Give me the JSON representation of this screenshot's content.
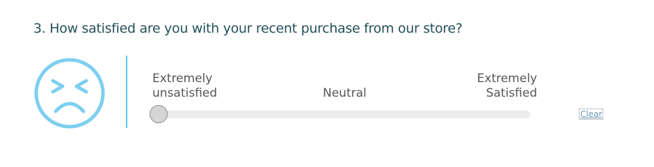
{
  "question": {
    "text": "3. How satisfied are you with your recent purchase from our store?"
  },
  "face_icon": {
    "name": "unsatisfied-face-icon",
    "color": "#7dcff0"
  },
  "accent_color": "#5cc2ea",
  "slider": {
    "label_left_line1": "Extremely",
    "label_left_line2": "unsatisfied",
    "label_mid": "Neutral",
    "label_right_line1": "Extremely",
    "label_right_line2": "Satisfied",
    "value": 0
  },
  "clear_label": "Clear"
}
